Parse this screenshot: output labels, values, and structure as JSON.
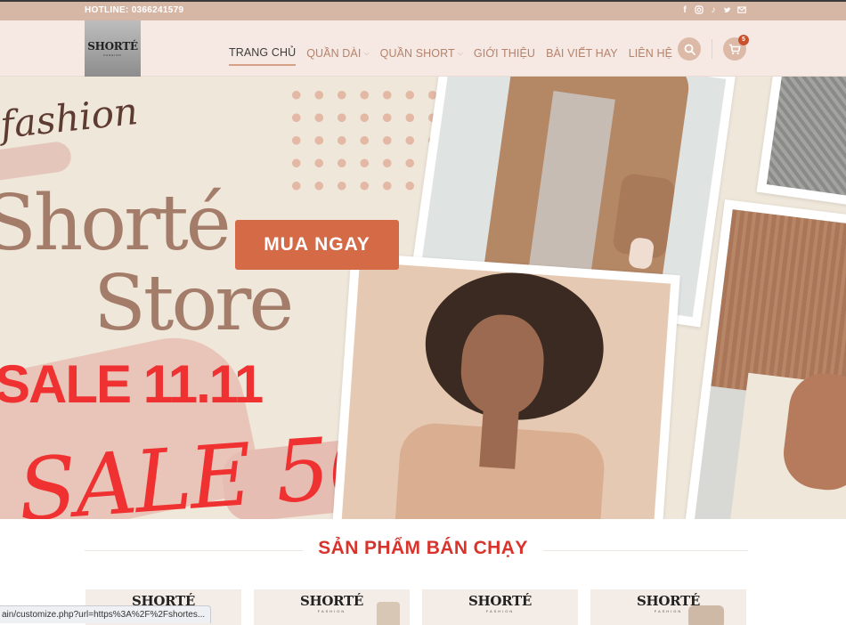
{
  "topbar": {
    "hotline": "HOTLINE: 0366241579",
    "social_icons": [
      "facebook-icon",
      "instagram-icon",
      "tiktok-icon",
      "twitter-icon",
      "email-icon"
    ]
  },
  "header": {
    "logo_text": "SHORTÉ",
    "logo_sub": "FASHION",
    "nav": [
      {
        "label": "TRANG CHỦ",
        "active": true
      },
      {
        "label": "QUẦN DÀI",
        "dropdown": true
      },
      {
        "label": "QUẦN SHORT",
        "dropdown": true
      },
      {
        "label": "GIỚI THIỆU"
      },
      {
        "label": "BÀI VIẾT HAY"
      },
      {
        "label": "LIÊN HỆ"
      }
    ],
    "cart_count": "5"
  },
  "hero": {
    "script_text": "fashion",
    "brand_line1": "Shorté",
    "brand_line2": "Store",
    "sale_text": "SALE 11.11",
    "sale_script": "SALE 50%",
    "cta_label": "MUA NGAY"
  },
  "section": {
    "title": "SẢN PHẨM BÁN CHẠY"
  },
  "products": [
    {
      "brand": "SHORTÉ",
      "sub": "FASHION"
    },
    {
      "brand": "SHORTÉ",
      "sub": "FASHION"
    },
    {
      "brand": "SHORTÉ",
      "sub": "FASHION"
    },
    {
      "brand": "SHORTÉ",
      "sub": "FASHION"
    }
  ],
  "statusbar": {
    "url": "ain/customize.php?url=https%3A%2F%2Fshortes..."
  },
  "colors": {
    "topbar": "#d6b7a6",
    "header_bg": "#f6e8e2",
    "nav_text": "#b4836d",
    "cta_bg": "#d56a47",
    "sale_red": "#ef3131",
    "section_title": "#d8342c"
  }
}
